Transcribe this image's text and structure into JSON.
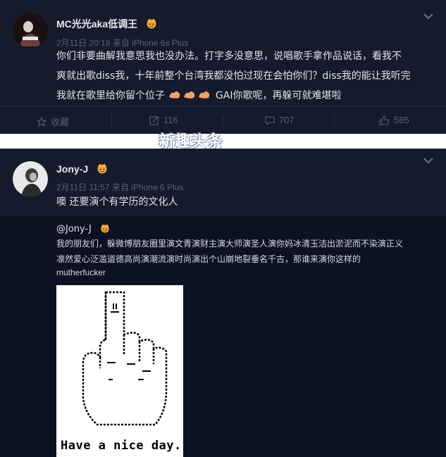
{
  "post1": {
    "username": "MC光光aka低调王",
    "meta": "2月11日 20:18 来自 iPhone 6s Plus",
    "content_line1": "你们非要曲解我意思我也没办法。打字多没意思，说唱歌手拿作品说话，看我不",
    "content_line2": "爽就出歌diss我，十年前整个台湾我都没怕过现在会怕你们？diss我的能让我听完",
    "content_line3_a": "我就在歌里给你留个位子",
    "content_line3_b": "GAI你歌呢，再躲可就难堪啦",
    "actions": {
      "favorite_label": "收藏",
      "repost_count": "116",
      "comment_count": "707",
      "like_count": "585"
    }
  },
  "watermark": "新趣头条",
  "post2": {
    "username": "Jony-J",
    "meta": "2月11日 11:57 来自 iPhone 6 Plus",
    "content": "噢 还要演个有学历的文化人",
    "repost": {
      "username": "@Jony-J",
      "text_line1": "我的朋友们，躲微博朋友圈里演文青演财主演大师演圣人演你妈冰清玉洁出淤泥而不染演正义",
      "text_line2": "凛然爱心泛滥道德高尚演潮流演时尚演出个山崩地裂垂名千古，那谁来演你这样的",
      "text_line3": "mutherfucker",
      "image_caption": "Have a nice day."
    }
  },
  "colors": {
    "background": "#151a2c",
    "repost_background": "#0d1222",
    "muted": "#5b6175",
    "text": "#e4e4ea"
  }
}
